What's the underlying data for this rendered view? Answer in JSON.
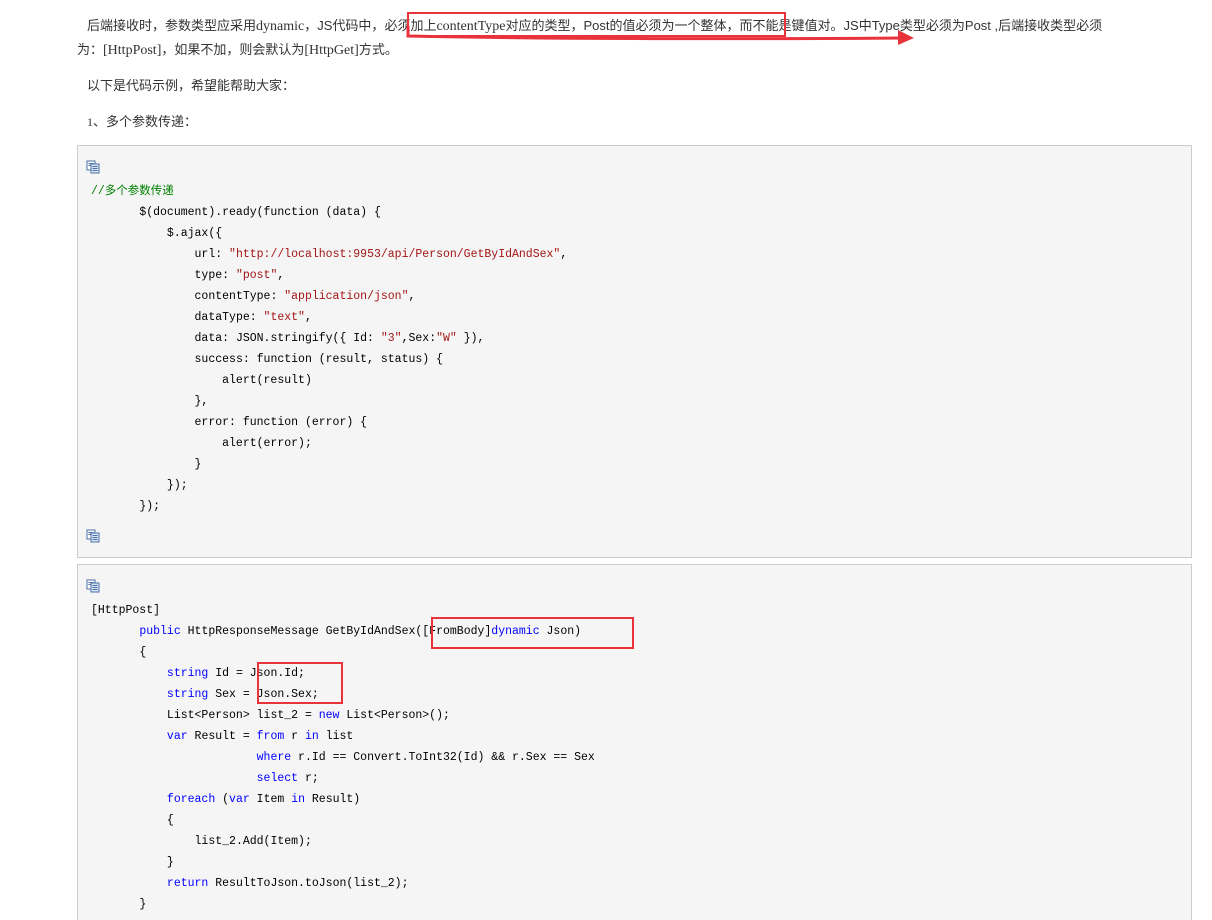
{
  "intro": {
    "line1_a": "后端接收时，参数类型应采用",
    "line1_b": "dynamic",
    "line1_c": "，",
    "line1_d": "JS",
    "line1_e": "代码中，",
    "line1_f": "必须加上",
    "line1_g": "contentType",
    "line1_h": "对应的类型，",
    "line1_i": "Post",
    "line1_j": "的值必须为一个整体",
    "line1_k": "，而不能是键值对。",
    "line1_l": "JS",
    "line1_m": "中",
    "line1_n": "Type",
    "line1_o": "类型必须为",
    "line1_p": "Post",
    "line1_q": " ,后端接收类型必须",
    "line2_a": "为：",
    "line2_b": "[HttpPost]",
    "line2_c": "，如果不加，则会默认为",
    "line2_d": "[HttpGet]",
    "line2_e": "方式。"
  },
  "examples_intro": "以下是代码示例，希望能帮助大家：",
  "section1": {
    "number": "1",
    "title": "、多个参数传递："
  },
  "icons": {
    "copy": "copy-code-icon"
  },
  "colors": {
    "highlight": "#e8323c",
    "keyword": "#0000ff",
    "string": "#a31515",
    "comment": "#008000",
    "code_bg": "#f5f5f5"
  },
  "js_code": {
    "comment": "//多个参数传递",
    "l1": "$(document).ready(function (data) {",
    "l2": "$.ajax({",
    "l3_key": "url: ",
    "l3_val": "\"http://localhost:9953/api/Person/GetByIdAndSex\"",
    "l3_end": ",",
    "l4_key": "type: ",
    "l4_val": "\"post\"",
    "l4_end": ",",
    "l5_key": "contentType: ",
    "l5_val": "\"application/json\"",
    "l5_end": ",",
    "l6_key": "dataType: ",
    "l6_val": "\"text\"",
    "l6_end": ",",
    "l7_key": "data: JSON.stringify({ Id: ",
    "l7_val1": "\"3\"",
    "l7_mid": ",Sex:",
    "l7_val2": "\"W\"",
    "l7_end": " }),",
    "l8": "success: function (result, status) {",
    "l9": "alert(result)",
    "l10": "},",
    "l11": "error: function (error) {",
    "l12": "alert(error);",
    "l13": "}",
    "l14": "});",
    "l15": "});"
  },
  "cs_code": {
    "attr": "[HttpPost]",
    "sig_kw": "public",
    "sig_mid": " HttpResponseMessage GetByIdAndSex(",
    "sig_attr": "[FromBody]",
    "sig_type": "dynamic",
    "sig_end": " Json)",
    "open1": "{",
    "l1_kw": "string",
    "l1_rest": " Id = Json.Id;",
    "l2_kw": "string",
    "l2_rest": " Sex = Json.Sex;",
    "l3_a": "List<Person> list_2 = ",
    "l3_kw": "new",
    "l3_b": " List<Person>();",
    "l4_kw1": "var",
    "l4_a": " Result = ",
    "l4_kw2": "from",
    "l4_b": " r ",
    "l4_kw3": "in",
    "l4_c": " list",
    "l5_kw": "where",
    "l5_rest": " r.Id == Convert.ToInt32(Id) && r.Sex == Sex",
    "l6_kw": "select",
    "l6_rest": " r;",
    "l7_kw1": "foreach",
    "l7_a": " (",
    "l7_kw2": "var",
    "l7_b": " Item ",
    "l7_kw3": "in",
    "l7_c": " Result)",
    "l8": "{",
    "l9": "list_2.Add(Item);",
    "l10": "}",
    "l11_kw": "return",
    "l11_rest": " ResultToJson.toJson(list_2);",
    "close1": "}"
  }
}
